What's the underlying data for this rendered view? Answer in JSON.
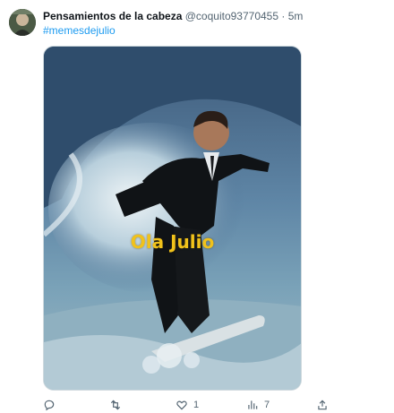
{
  "tweet": {
    "display_name": "Pensamientos de la cabeza",
    "handle": "@coquito93770455",
    "separator": "·",
    "time": "5m",
    "hashtag": "#memesdejulio",
    "image_caption": "Ola Julio"
  },
  "actions": {
    "reply_count": "",
    "retweet_count": "",
    "like_count": "1",
    "views_count": "7"
  },
  "colors": {
    "accent": "#1d9bf0",
    "muted": "#536471",
    "caption": "#f1c21b"
  },
  "icons": [
    "reply-icon",
    "retweet-icon",
    "like-icon",
    "views-icon",
    "share-icon"
  ]
}
